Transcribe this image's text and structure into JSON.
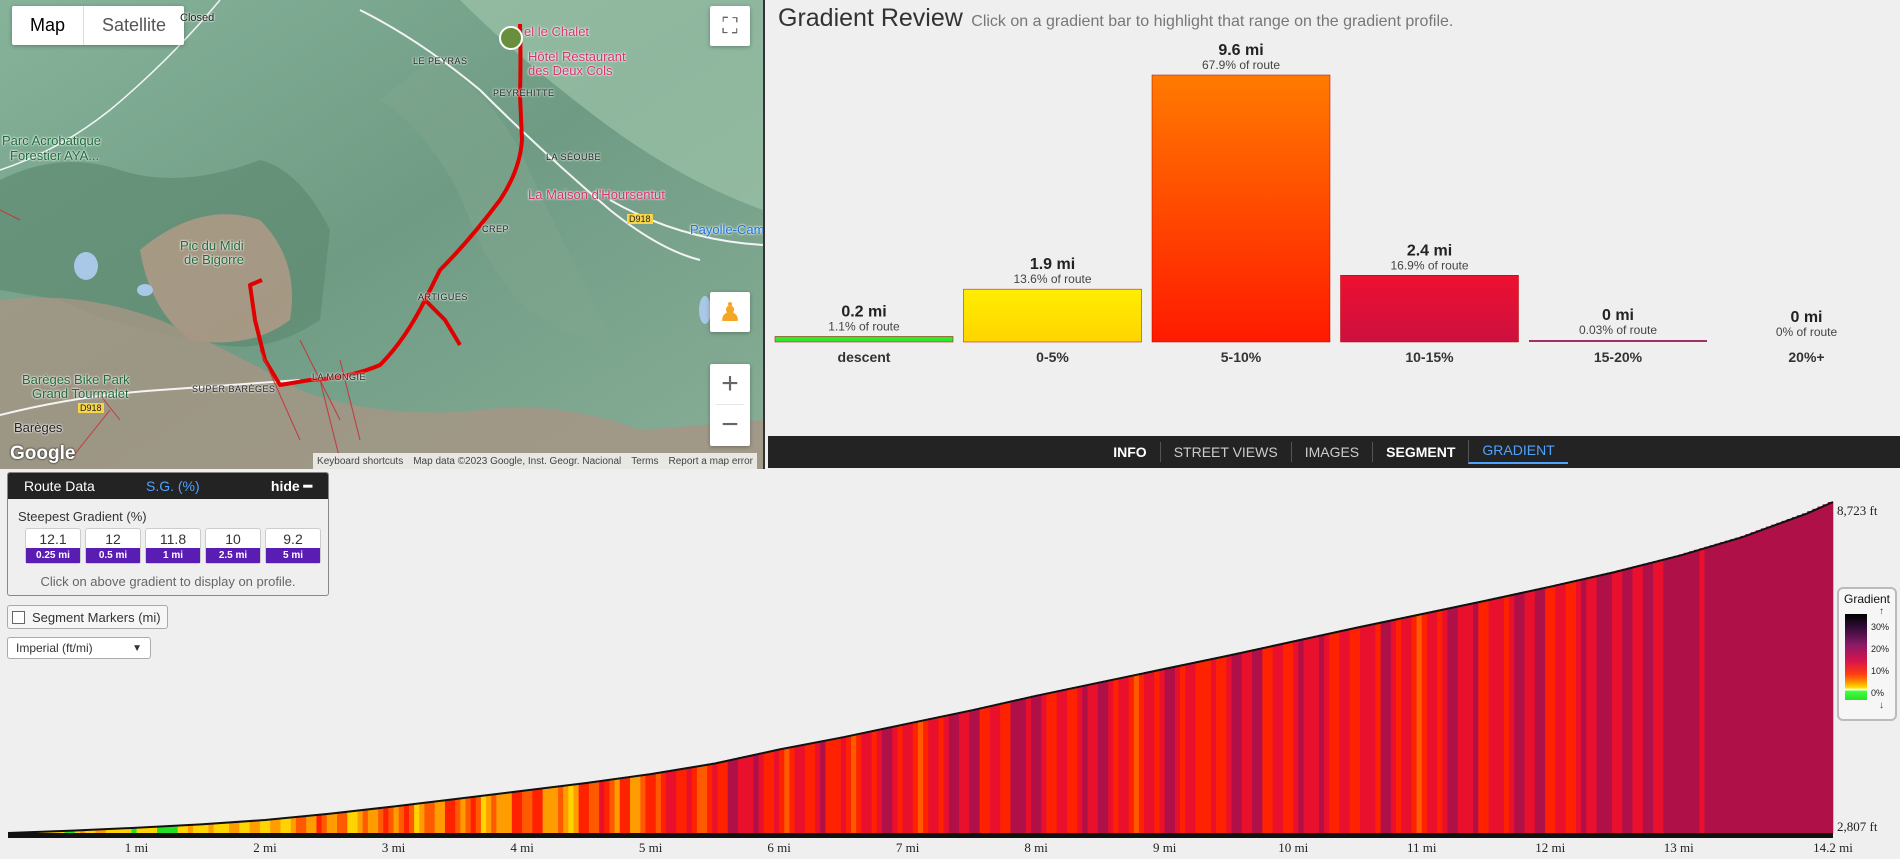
{
  "map": {
    "type_buttons": [
      "Map",
      "Satellite"
    ],
    "fullscreen_icon": "fullscreen-icon",
    "pegman_icon": "pegman-icon",
    "zoom_in": "+",
    "zoom_out": "−",
    "logo": "Google",
    "footer": [
      "Keyboard shortcuts",
      "Map data ©2023 Google, Inst. Geogr. Nacional",
      "Terms",
      "Report a map error"
    ],
    "labels": {
      "closed": "Closed",
      "le_peyras": "LE PEYRAS",
      "hotel_chalet": "el le Chalet",
      "hotel_restaurant": "Hôtel Restaurant",
      "hotel_restaurant2": "des Deux Cols",
      "peyrehitte": "PEYREHITTE",
      "parc": "Parc Acrobatique",
      "parc2": "Forestier AYA...",
      "la_seoube": "LA SÉOUBE",
      "maison": "La Maison d'Hoursentut",
      "d918": "D918",
      "payolle": "Payolle-Cam",
      "crep": "CREP",
      "pic_midi": "Pic du Midi",
      "pic_midi2": "de Bigorre",
      "artigues": "ARTIGUES",
      "bareges_bike": "Barèges Bike Park",
      "bareges_bike2": "Grand Tourmalet",
      "super_bareges": "SUPER BARÈGES",
      "la_mongie": "LA MONGIE",
      "d918b": "D918",
      "bareges": "Barèges"
    }
  },
  "gradient_review": {
    "title": "Gradient Review",
    "subtitle": "Click on a gradient bar to highlight that range on the gradient profile."
  },
  "tabs": [
    "INFO",
    "STREET VIEWS",
    "IMAGES",
    "SEGMENT",
    "GRADIENT"
  ],
  "route_panel": {
    "tab_route": "Route Data",
    "tab_sg": "S.G. (%)",
    "hide": "hide",
    "steepest_label": "Steepest Gradient (%)",
    "steepest": [
      {
        "value": "12.1",
        "dist": "0.25 mi"
      },
      {
        "value": "12",
        "dist": "0.5 mi"
      },
      {
        "value": "11.8",
        "dist": "1 mi"
      },
      {
        "value": "10",
        "dist": "2.5 mi"
      },
      {
        "value": "9.2",
        "dist": "5 mi"
      }
    ],
    "hint": "Click on above gradient to display on profile."
  },
  "segment_markers": "Segment Markers (mi)",
  "units_select": "Imperial (ft/mi)",
  "legend": {
    "title": "Gradient",
    "ticks": [
      "30%",
      "20%",
      "10%",
      "0%"
    ]
  },
  "chart_data": [
    {
      "type": "bar",
      "title": "",
      "categories": [
        "descent",
        "0-5%",
        "5-10%",
        "10-15%",
        "15-20%",
        "20%+"
      ],
      "values": [
        0.2,
        1.9,
        9.6,
        2.4,
        0,
        0
      ],
      "value_labels": [
        "0.2 mi",
        "1.9 mi",
        "9.6 mi",
        "2.4 mi",
        "0 mi",
        "0 mi"
      ],
      "percent_labels": [
        "1.1% of route",
        "13.6% of route",
        "67.9% of route",
        "16.9% of route",
        "0.03% of route",
        "0% of route"
      ],
      "colors": [
        [
          "#2ee82e",
          "#2ee82e"
        ],
        [
          "#ffd400",
          "#ffee00"
        ],
        [
          "#ff1a00",
          "#ff7a00"
        ],
        [
          "#cc1040",
          "#ee1030"
        ],
        [
          "#a0306a",
          "#a0306a"
        ],
        [
          "#efefef",
          "#efefef"
        ]
      ],
      "ylim": [
        0,
        10
      ]
    },
    {
      "type": "area",
      "title": "",
      "x_ticks": [
        "1 mi",
        "2 mi",
        "3 mi",
        "4 mi",
        "5 mi",
        "6 mi",
        "7 mi",
        "8 mi",
        "9 mi",
        "10 mi",
        "11 mi",
        "12 mi",
        "13 mi",
        "14.2 mi"
      ],
      "x": [
        0,
        0.5,
        1,
        1.5,
        2,
        2.5,
        3,
        3.5,
        4,
        4.5,
        5,
        5.5,
        6,
        6.5,
        7,
        7.5,
        8,
        8.5,
        9,
        9.5,
        10,
        10.5,
        11,
        11.5,
        12,
        12.5,
        13,
        13.5,
        14,
        14.2
      ],
      "y": [
        2807,
        2850,
        2900,
        2960,
        3040,
        3150,
        3280,
        3420,
        3560,
        3700,
        3860,
        4050,
        4300,
        4520,
        4760,
        5000,
        5260,
        5500,
        5740,
        5980,
        6230,
        6480,
        6720,
        6960,
        7210,
        7470,
        7760,
        8100,
        8520,
        8723
      ],
      "y_labels": [
        "2,807 ft",
        "8,723 ft"
      ],
      "ylim": [
        2807,
        8723
      ],
      "xlim": [
        0,
        14.2
      ]
    }
  ]
}
